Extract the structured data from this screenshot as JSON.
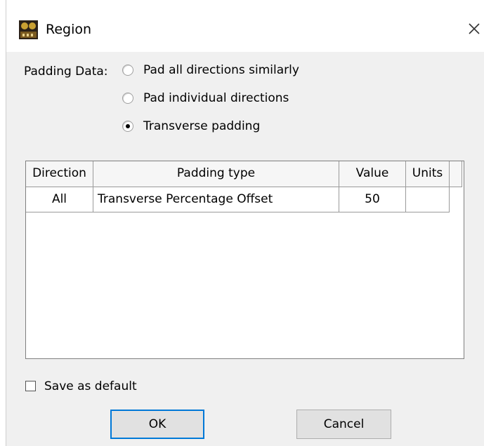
{
  "window": {
    "title": "Region",
    "icon": "region-app-icon",
    "close_icon": "close-icon"
  },
  "padding": {
    "label": "Padding Data:",
    "options": [
      {
        "label": "Pad all directions similarly",
        "selected": false
      },
      {
        "label": "Pad individual directions",
        "selected": false
      },
      {
        "label": "Transverse padding",
        "selected": true
      }
    ]
  },
  "table": {
    "headers": [
      "Direction",
      "Padding type",
      "Value",
      "Units",
      ""
    ],
    "rows": [
      {
        "direction": "All",
        "padding_type": "Transverse Percentage Offset",
        "value": "50",
        "units": ""
      }
    ]
  },
  "save_default": {
    "label": "Save as default",
    "checked": false
  },
  "buttons": {
    "ok": "OK",
    "cancel": "Cancel"
  },
  "colors": {
    "dialog_bg": "#f0f0f0",
    "title_bg": "#ffffff",
    "focus_border": "#0078d7",
    "button_bg": "#e1e1e1"
  }
}
